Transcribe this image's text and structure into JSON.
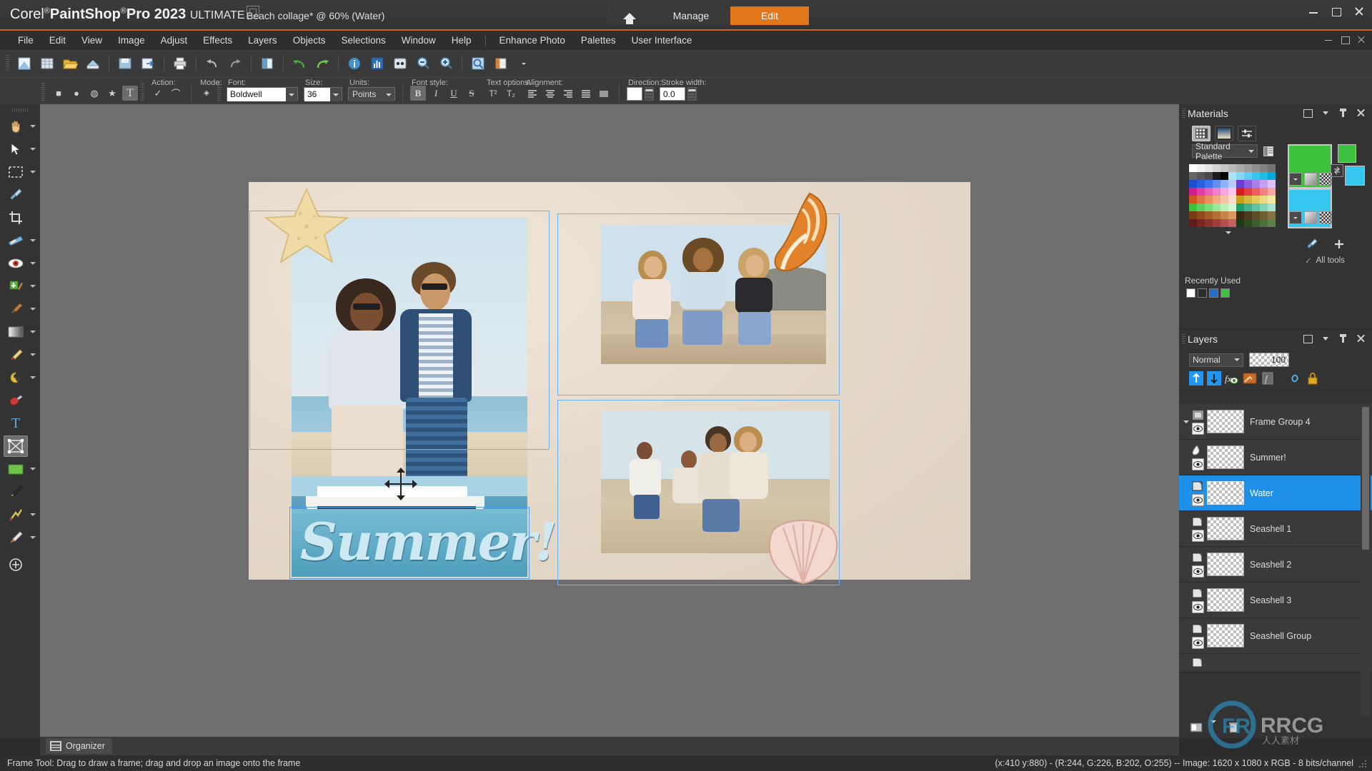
{
  "app": {
    "brand_corel": "Corel",
    "brand_reg": "®",
    "brand_name": "PaintShop",
    "brand_reg2": "®",
    "brand_pro": "Pro 2023",
    "edition": "ULTIMATE",
    "document_title": "Beach collage* @  60% (Water)"
  },
  "titlebar": {
    "home_label": "home-icon",
    "manage_tab": "Manage",
    "edit_tab": "Edit",
    "minimize": "minimize-icon",
    "maximize": "maximize-icon",
    "close": "close-icon"
  },
  "menubar": {
    "items": [
      {
        "label": "File"
      },
      {
        "label": "Edit"
      },
      {
        "label": "View"
      },
      {
        "label": "Image"
      },
      {
        "label": "Adjust"
      },
      {
        "label": "Effects"
      },
      {
        "label": "Layers"
      },
      {
        "label": "Objects"
      },
      {
        "label": "Selections"
      },
      {
        "label": "Window"
      },
      {
        "label": "Help"
      }
    ],
    "right_items": [
      {
        "label": "Enhance Photo"
      },
      {
        "label": "Palettes"
      },
      {
        "label": "User Interface"
      }
    ]
  },
  "standard_toolbar": {
    "buttons": [
      {
        "name": "new-image",
        "glyph": "▧"
      },
      {
        "name": "new-from-template",
        "glyph": "▦"
      },
      {
        "name": "open",
        "glyph": "📂"
      },
      {
        "name": "browse",
        "glyph": "▤"
      },
      {
        "name": "save",
        "glyph": "▣"
      },
      {
        "name": "save-as",
        "glyph": "▢"
      },
      {
        "name": "print",
        "glyph": "🖶"
      },
      {
        "name": "undo-history",
        "glyph": "↰"
      },
      {
        "name": "redo-history",
        "glyph": "↳"
      },
      {
        "name": "duplicate",
        "glyph": "◨"
      },
      {
        "name": "undo",
        "glyph": "↺"
      },
      {
        "name": "redo",
        "glyph": "↻"
      },
      {
        "name": "image-info",
        "glyph": "ⓘ"
      },
      {
        "name": "histogram",
        "glyph": "▥"
      },
      {
        "name": "scriptbar",
        "glyph": "◉"
      },
      {
        "name": "zoom-out",
        "glyph": "−"
      },
      {
        "name": "zoom-in",
        "glyph": "+"
      },
      {
        "name": "preview",
        "glyph": "◎"
      },
      {
        "name": "workspace",
        "glyph": "▤"
      }
    ]
  },
  "tool_options": {
    "shape_buttons": [
      {
        "name": "rectangle-shape",
        "glyph": "■"
      },
      {
        "name": "ellipse-shape",
        "glyph": "●"
      },
      {
        "name": "callout-shape",
        "glyph": "◍"
      },
      {
        "name": "star-shape",
        "glyph": "★"
      },
      {
        "name": "text-shape",
        "glyph": "T"
      }
    ],
    "action_label": "Action:",
    "action_buttons": [
      {
        "name": "apply-check",
        "glyph": "✓"
      },
      {
        "name": "curve-action",
        "glyph": "⌒"
      }
    ],
    "mode_label": "Mode:",
    "mode_glyph": "◈",
    "font_label": "Font:",
    "font_value": "Boldwell",
    "size_label": "Size:",
    "size_value": "36",
    "units_label": "Units:",
    "units_value": "Points",
    "font_style_label": "Font style:",
    "style_buttons": [
      {
        "name": "bold-button",
        "glyph": "B",
        "selected": true
      },
      {
        "name": "italic-button",
        "glyph": "I",
        "selected": false
      },
      {
        "name": "underline-button",
        "glyph": "U",
        "selected": false
      },
      {
        "name": "strikethrough-button",
        "glyph": "S",
        "selected": false
      }
    ],
    "text_options_label": "Text options:",
    "text_option_buttons": [
      {
        "name": "superscript-button",
        "glyph": "T²"
      },
      {
        "name": "subscript-button",
        "glyph": "T₂"
      }
    ],
    "alignment_label": "Alignment:",
    "alignment_buttons": [
      {
        "name": "align-left-button"
      },
      {
        "name": "align-center-button"
      },
      {
        "name": "align-right-button"
      },
      {
        "name": "align-justify-button"
      },
      {
        "name": "align-block-button"
      }
    ],
    "direction_label": "Direction:",
    "direction_value": "direction-swatch",
    "stroke_label": "Stroke width:",
    "stroke_value": "0.0"
  },
  "tools_panel": {
    "tools": [
      {
        "name": "pan-tool",
        "glyph": "✋",
        "flyout": true,
        "selected": false
      },
      {
        "name": "pick-tool",
        "glyph": "➤",
        "flyout": true,
        "selected": false
      },
      {
        "name": "selection-tool",
        "glyph": "▭",
        "flyout": true,
        "selected": false
      },
      {
        "name": "dropper-tool",
        "glyph": "💉",
        "flyout": false,
        "selected": false
      },
      {
        "name": "crop-tool",
        "glyph": "⌗",
        "flyout": false,
        "selected": false
      },
      {
        "name": "straighten-tool",
        "glyph": "▱",
        "flyout": true,
        "selected": false
      },
      {
        "name": "red-eye-tool",
        "glyph": "◉",
        "flyout": true,
        "selected": false
      },
      {
        "name": "makeover-tool",
        "glyph": "▤",
        "flyout": true,
        "selected": false
      },
      {
        "name": "clone-brush-tool",
        "glyph": "🖌",
        "flyout": true,
        "selected": false
      },
      {
        "name": "gradient-tool",
        "glyph": "▮",
        "flyout": true,
        "selected": false
      },
      {
        "name": "eraser-tool",
        "glyph": "✐",
        "flyout": true,
        "selected": false
      },
      {
        "name": "color-changer-tool",
        "glyph": "◐",
        "flyout": true,
        "selected": false
      },
      {
        "name": "flood-fill-tool",
        "glyph": "🎨",
        "flyout": false,
        "selected": false
      },
      {
        "name": "text-tool",
        "glyph": "T",
        "flyout": false,
        "selected": false
      },
      {
        "name": "frame-tool",
        "glyph": "⊠",
        "flyout": false,
        "selected": true
      },
      {
        "name": "preset-shape-tool",
        "glyph": "▬",
        "flyout": true,
        "selected": false
      },
      {
        "name": "pen-tool",
        "glyph": "✒",
        "flyout": false,
        "selected": false
      },
      {
        "name": "warp-brush-tool",
        "glyph": "〽",
        "flyout": true,
        "selected": false
      },
      {
        "name": "smooth-brush-tool",
        "glyph": "🖊",
        "flyout": true,
        "selected": false
      },
      {
        "name": "add-tool",
        "glyph": "⊕",
        "flyout": false,
        "selected": false
      }
    ]
  },
  "canvas": {
    "artwork_title": "Summer!",
    "frames": [
      "frame-left",
      "frame-top-right",
      "frame-bottom-right"
    ],
    "stickers": [
      "starfish-sticker",
      "conch-shell-sticker",
      "scallop-shell-sticker"
    ],
    "cruise_ship": "cruise-ship-photo"
  },
  "materials_panel": {
    "title": "Materials",
    "tabs": [
      {
        "name": "swatches-tab",
        "selected": true
      },
      {
        "name": "gradient-tab",
        "selected": false
      },
      {
        "name": "sliders-tab",
        "selected": false
      }
    ],
    "palette_label": "Standard Palette",
    "foreground_color": "#3cc23c",
    "background_color": "#35c8ee",
    "accent_green": "#3cc23c",
    "all_tools_label": "All tools",
    "recently_used_label": "Recently Used",
    "recent_swatches": [
      "#ffffff",
      "#2b2b2b",
      "#1f6fd0",
      "#3cc23c"
    ],
    "swatch_rows": [
      [
        "#ffffff",
        "#f2f2f2",
        "#e4e4e4",
        "#d6d6d6",
        "#c8c8c8",
        "#bababa",
        "#acacac",
        "#9e9e9e",
        "#909090",
        "#828282",
        "#747474"
      ],
      [
        "#666666",
        "#585858",
        "#4a4a4a",
        "#3c3c3c",
        "#000000",
        "#a6e4f7",
        "#86d9f5",
        "#5ecdf2",
        "#35c8ee",
        "#1fbbe4",
        "#00aadd"
      ],
      [
        "#1f3fd0",
        "#2b57e0",
        "#3f73ec",
        "#5f8ff3",
        "#8fb2f8",
        "#b6cdfb",
        "#6a3fd0",
        "#8a5fe0",
        "#a97fec",
        "#c49ff3",
        "#dcc3fb"
      ],
      [
        "#d01f8f",
        "#e03fa7",
        "#ec5fb9",
        "#f37fcb",
        "#f8a7dc",
        "#fbc7ea",
        "#d01f1f",
        "#e03f3f",
        "#ec5f5f",
        "#f38181",
        "#f8a7a7"
      ],
      [
        "#d0561f",
        "#e0743f",
        "#ec8f5f",
        "#f3aa81",
        "#f8c4a7",
        "#fbddca",
        "#c2a21f",
        "#d4b73f",
        "#e2cb5f",
        "#ecdb81",
        "#f4e8a7"
      ],
      [
        "#3cc23c",
        "#5bd05b",
        "#79dd79",
        "#98e898",
        "#b8f0b8",
        "#d5f7d5",
        "#1f9c6f",
        "#3fb089",
        "#5fc2a1",
        "#81d3ba",
        "#a7e2ce"
      ],
      [
        "#7a3a12",
        "#8d4a1c",
        "#a25c27",
        "#b57034",
        "#c78645",
        "#d79c5d",
        "#3a2a12",
        "#4c3a1c",
        "#5f4c27",
        "#726034",
        "#847445"
      ]
    ]
  },
  "layers_panel": {
    "title": "Layers",
    "blend_mode": "Normal",
    "opacity": "100",
    "toolbar_icons": [
      {
        "name": "new-raster-layer-icon"
      },
      {
        "name": "new-mask-layer-icon"
      },
      {
        "name": "new-adjustment-layer-icon"
      },
      {
        "name": "new-art-media-layer-icon"
      },
      {
        "name": "new-vector-layer-icon"
      },
      {
        "name": "link-layers-icon"
      },
      {
        "name": "lock-layers-icon"
      }
    ],
    "layers": [
      {
        "name": "Frame Group 4",
        "selected": false,
        "group": true,
        "indent": 0
      },
      {
        "name": "Summer!",
        "selected": false,
        "group": false,
        "indent": 1
      },
      {
        "name": "Water",
        "selected": true,
        "group": false,
        "indent": 1
      },
      {
        "name": "Seashell 1",
        "selected": false,
        "group": false,
        "indent": 1
      },
      {
        "name": "Seashell 2",
        "selected": false,
        "group": false,
        "indent": 1
      },
      {
        "name": "Seashell 3",
        "selected": false,
        "group": false,
        "indent": 1
      },
      {
        "name": "Seashell Group",
        "selected": false,
        "group": false,
        "indent": 1
      }
    ]
  },
  "statusbar": {
    "organizer_label": "Organizer",
    "hint": "Frame Tool: Drag to draw a frame; drag and drop an image onto the frame",
    "coords": "(x:410 y:880) - (R:244, G:226, B:202, O:255) -- Image:  1620 x 1080 x RGB - 8 bits/channel"
  }
}
